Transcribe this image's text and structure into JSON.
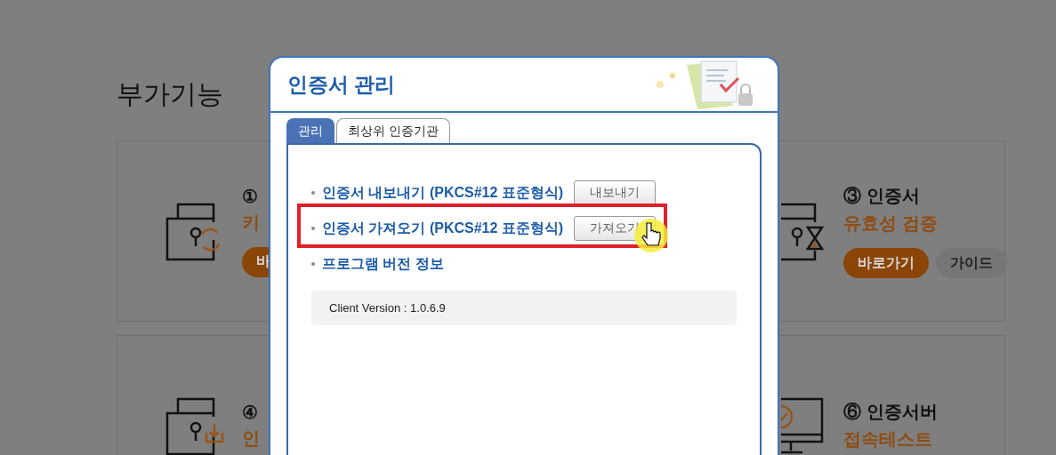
{
  "page": {
    "title": "부가기능",
    "cards": [
      {
        "kind": "refresh",
        "heading": "①",
        "subheading": "키",
        "buttons": [
          {
            "label": "바",
            "kind": "primary"
          }
        ]
      },
      {
        "kind": "validate",
        "heading": "③ 인증서",
        "subheading": "유효성 검증",
        "buttons": [
          {
            "label": "바로가기",
            "kind": "primary"
          },
          {
            "label": "가이드",
            "kind": "secondary"
          }
        ]
      },
      {
        "kind": "download",
        "heading": "④",
        "subheading": "인"
      },
      {
        "kind": "monitor",
        "heading": "⑥ 인증서버",
        "subheading": "접속테스트"
      }
    ]
  },
  "dialog": {
    "title": "인증서 관리",
    "tabs": [
      {
        "label": "관리",
        "selected": true
      },
      {
        "label": "최상위 인증기관",
        "selected": false
      }
    ],
    "items": [
      {
        "label": "인증서 내보내기 (PKCS#12 표준형식)",
        "button": "내보내기",
        "highlighted": false
      },
      {
        "label": "인증서 가져오기 (PKCS#12 표준형식)",
        "button": "가져오기",
        "highlighted": true
      },
      {
        "label": "프로그램 버전 정보",
        "highlighted": false
      }
    ],
    "version": "Client Version : 1.0.6.9"
  }
}
